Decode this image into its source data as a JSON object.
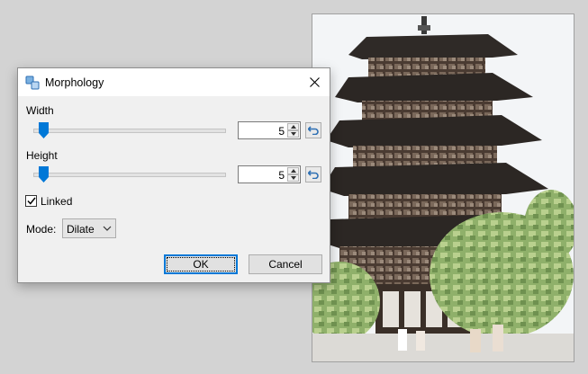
{
  "dialog": {
    "title": "Morphology",
    "close_icon": "close-icon",
    "width_label": "Width",
    "width_value": "5",
    "height_label": "Height",
    "height_value": "5",
    "linked_label": "Linked",
    "linked_checked": true,
    "mode_label": "Mode:",
    "mode_value": "Dilate",
    "ok_label": "OK",
    "cancel_label": "Cancel"
  },
  "colors": {
    "accent": "#0078d7",
    "dialog_bg": "#f0f0f0",
    "workspace_bg": "#d3d3d3"
  }
}
